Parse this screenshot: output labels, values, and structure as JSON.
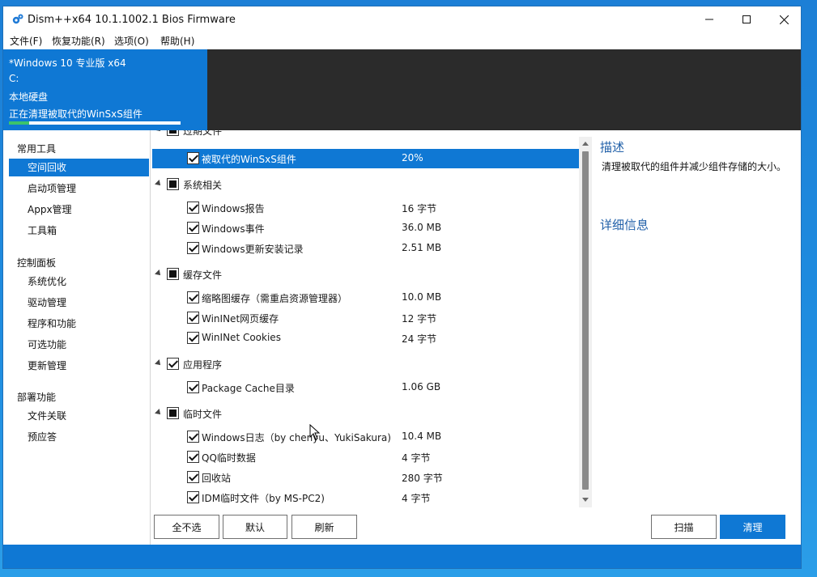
{
  "window": {
    "title": "Dism++x64 10.1.1002.1 Bios Firmware"
  },
  "menu": [
    "文件(F)",
    "恢复功能(R)",
    "选项(O)",
    "帮助(H)"
  ],
  "session": {
    "os": "*Windows 10 专业版 x64",
    "drive": "C:",
    "disk_type": "本地硬盘",
    "status": "正在清理被取代的WinSxS组件",
    "progress": 0.12
  },
  "sidebar": {
    "groups": [
      {
        "title": "常用工具",
        "items": [
          "空间回收",
          "启动项管理",
          "Appx管理",
          "工具箱"
        ]
      },
      {
        "title": "控制面板",
        "items": [
          "系统优化",
          "驱动管理",
          "程序和功能",
          "可选功能",
          "更新管理"
        ]
      },
      {
        "title": "部署功能",
        "items": [
          "文件关联",
          "预应答"
        ]
      }
    ],
    "active": "空间回收"
  },
  "list": {
    "partial_group": "过期文件",
    "rows": [
      {
        "type": "item",
        "label": "被取代的WinSxS组件",
        "size": "20%",
        "checked": true,
        "selected": true
      },
      {
        "type": "group",
        "label": "系统相关",
        "state": "partial"
      },
      {
        "type": "item",
        "label": "Windows报告",
        "size": "16 字节",
        "checked": true
      },
      {
        "type": "item",
        "label": "Windows事件",
        "size": "36.0 MB",
        "checked": true
      },
      {
        "type": "item",
        "label": "Windows更新安装记录",
        "size": "2.51 MB",
        "checked": true
      },
      {
        "type": "group",
        "label": "缓存文件",
        "state": "partial"
      },
      {
        "type": "item",
        "label": "缩略图缓存（需重启资源管理器）",
        "size": "10.0 MB",
        "checked": true
      },
      {
        "type": "item",
        "label": "WinINet网页缓存",
        "size": "12 字节",
        "checked": true
      },
      {
        "type": "item",
        "label": "WinINet Cookies",
        "size": "24 字节",
        "checked": true
      },
      {
        "type": "group",
        "label": "应用程序",
        "state": "checked"
      },
      {
        "type": "item",
        "label": "Package Cache目录",
        "size": "1.06 GB",
        "checked": true
      },
      {
        "type": "group",
        "label": "临时文件",
        "state": "partial"
      },
      {
        "type": "item",
        "label": "Windows日志（by chenyu、YukiSakura)",
        "size": "10.4 MB",
        "checked": true
      },
      {
        "type": "item",
        "label": "QQ临时数据",
        "size": "4 字节",
        "checked": true
      },
      {
        "type": "item",
        "label": "回收站",
        "size": "280 字节",
        "checked": true
      },
      {
        "type": "item",
        "label": "IDM临时文件（by MS-PC2)",
        "size": "4 字节",
        "checked": true
      }
    ]
  },
  "detail": {
    "desc_title": "描述",
    "desc_text": "清理被取代的组件并减少组件存储的大小。",
    "more_title": "详细信息"
  },
  "buttons": {
    "select_none": "全不选",
    "default": "默认",
    "refresh": "刷新",
    "scan": "扫描",
    "clean": "清理"
  },
  "colors": {
    "accent": "#0f78d4",
    "header": "#2b2b2b",
    "progress": "#3cc36b",
    "link": "#1f5fa8"
  }
}
